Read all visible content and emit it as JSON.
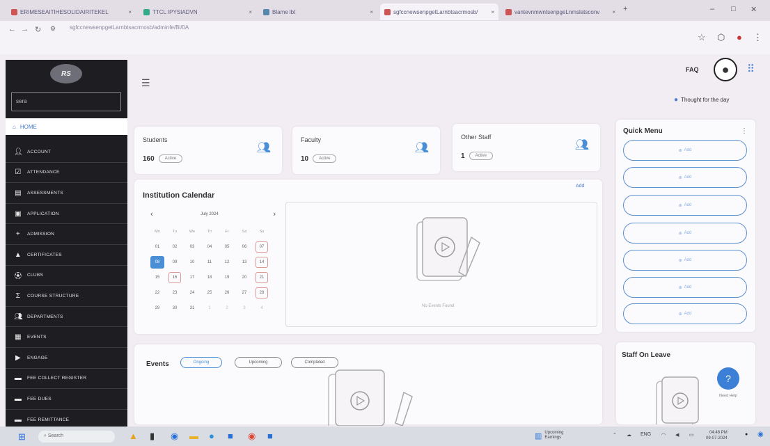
{
  "browser": {
    "tabs": [
      {
        "label": "ERIMESEAITIHESOLIDAIRITEKEL"
      },
      {
        "label": "TTCL IPYSIADVN"
      },
      {
        "label": "Blame lbt"
      },
      {
        "label": "sgfccnewsenpgetLarnbtsacrmosb/"
      },
      {
        "label": "vantevnmwntsenpgeLnmslatsconv"
      }
    ],
    "url": "sgfccnewsenpgetLarnbtsacrmosb/adminfe/Bl/0A"
  },
  "sidebar": {
    "logo": "RS",
    "search_placeholder": "sera",
    "home": "HOME",
    "items": [
      {
        "label": "ACCOUNT",
        "icon": "person-icon"
      },
      {
        "label": "ATTENDANCE",
        "icon": "checkbox-icon"
      },
      {
        "label": "ASSESSMENTS",
        "icon": "document-icon"
      },
      {
        "label": "APPLICATION",
        "icon": "file-icon"
      },
      {
        "label": "ADMISSION",
        "icon": "add-person-icon"
      },
      {
        "label": "CERTIFICATES",
        "icon": "graduation-cap-icon"
      },
      {
        "label": "CLUBS",
        "icon": "football-icon"
      },
      {
        "label": "COURSE STRUCTURE",
        "icon": "sigma-icon"
      },
      {
        "label": "DEPARTMENTS",
        "icon": "people-icon"
      },
      {
        "label": "EVENTS",
        "icon": "event-icon"
      },
      {
        "label": "ENGAGE",
        "icon": "engage-icon"
      },
      {
        "label": "FEE COLLECT REGISTER",
        "icon": "register-icon"
      },
      {
        "label": "FEE DUES",
        "icon": "dues-icon"
      },
      {
        "label": "FEE REMITTANCE",
        "icon": "remittance-icon"
      }
    ]
  },
  "header": {
    "faq": "FAQ",
    "thought": "Thought for the day"
  },
  "stats": [
    {
      "title": "Students",
      "value": "160",
      "badge": "Active"
    },
    {
      "title": "Faculty",
      "value": "10",
      "badge": "Active"
    },
    {
      "title": "Other Staff",
      "value": "1",
      "badge": "Active"
    }
  ],
  "calendar": {
    "title": "Institution Calendar",
    "add_label": "Add",
    "month_label": "July 2024",
    "days_of_week": [
      "Mo",
      "Tu",
      "We",
      "Th",
      "Fr",
      "Sa",
      "Su"
    ],
    "weeks": [
      [
        "01",
        "02",
        "03",
        "04",
        "05",
        "06",
        "07"
      ],
      [
        "08",
        "09",
        "10",
        "11",
        "12",
        "13",
        "14"
      ],
      [
        "15",
        "16",
        "17",
        "18",
        "19",
        "20",
        "21"
      ],
      [
        "22",
        "23",
        "24",
        "25",
        "26",
        "27",
        "28"
      ],
      [
        "29",
        "30",
        "31",
        "1",
        "2",
        "3",
        "4"
      ]
    ],
    "no_events_text": "No Events Found"
  },
  "events": {
    "title": "Events",
    "filters": [
      "Ongoing",
      "Upcoming",
      "Completed"
    ]
  },
  "quick_menu": {
    "title": "Quick Menu",
    "buttons": [
      "Add",
      "Add",
      "Add",
      "Add",
      "Add",
      "Add",
      "Add"
    ]
  },
  "staff_on_leave": {
    "title": "Staff On Leave"
  },
  "help": {
    "label": "Need Help"
  },
  "taskbar": {
    "search": "Search",
    "weather": "Upcoming",
    "weather_sub": "Earnings",
    "lang": "ENG",
    "time": "04:48 PM",
    "date": "09-07-2024"
  },
  "colors": {
    "accent": "#4a8fd6",
    "sidebar_bg": "#1e1e22",
    "page_bg": "#f1edf3"
  }
}
